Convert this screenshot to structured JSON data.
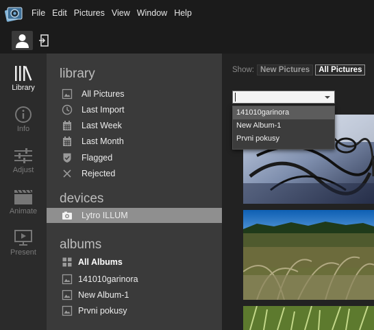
{
  "menu": {
    "items": [
      "File",
      "Edit",
      "Pictures",
      "View",
      "Window",
      "Help"
    ]
  },
  "toolbar": {
    "user_icon": "user-icon",
    "exit_icon": "exit-icon"
  },
  "rail": {
    "items": [
      {
        "label": "Library",
        "icon": "library-icon",
        "active": true
      },
      {
        "label": "Info",
        "icon": "info-icon",
        "active": false
      },
      {
        "label": "Adjust",
        "icon": "sliders-icon",
        "active": false
      },
      {
        "label": "Animate",
        "icon": "clapper-icon",
        "active": false
      },
      {
        "label": "Present",
        "icon": "present-icon",
        "active": false
      }
    ]
  },
  "library": {
    "title": "library",
    "items": [
      {
        "label": "All Pictures",
        "icon": "picture-icon"
      },
      {
        "label": "Last Import",
        "icon": "clock-icon"
      },
      {
        "label": "Last Week",
        "icon": "calendar-icon"
      },
      {
        "label": "Last Month",
        "icon": "calendar-icon"
      },
      {
        "label": "Flagged",
        "icon": "flag-shield-icon"
      },
      {
        "label": "Rejected",
        "icon": "x-icon"
      }
    ]
  },
  "devices": {
    "title": "devices",
    "items": [
      {
        "label": "Lytro ILLUM",
        "icon": "camera-icon",
        "selected": true
      }
    ]
  },
  "albums": {
    "title": "albums",
    "items": [
      {
        "label": "All Albums",
        "icon": "grid-icon"
      },
      {
        "label": "141010garinora",
        "icon": "picture-icon"
      },
      {
        "label": "New Album-1",
        "icon": "picture-icon"
      },
      {
        "label": "Prvni pokusy",
        "icon": "picture-icon"
      }
    ]
  },
  "main": {
    "show_label": "Show:",
    "show_new": "New Pictures",
    "show_all": "All Pictures",
    "album_select_value": "",
    "dropdown_options": [
      "141010garinora",
      "New Album-1",
      "Prvni pokusy"
    ]
  },
  "colors": {
    "panel_bg": "#3a3a3a",
    "rail_bg": "#2b2b2b",
    "selected_row": "#8f8f8f",
    "main_bg": "#222222"
  }
}
